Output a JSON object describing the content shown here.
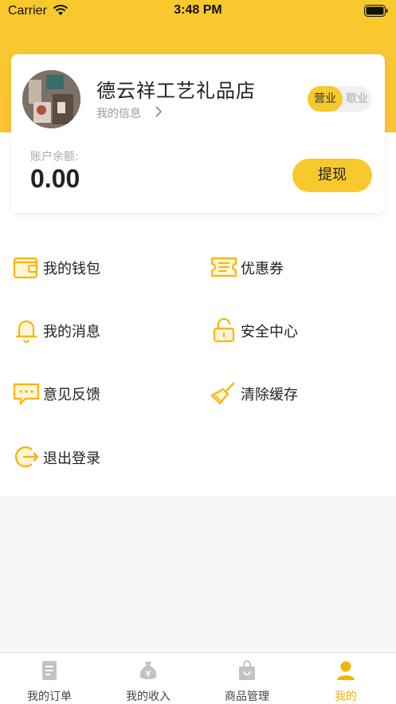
{
  "status_bar": {
    "carrier": "Carrier",
    "time": "3:48 PM"
  },
  "colors": {
    "accent": "#f8c92d",
    "active_tab": "#f5b400",
    "icon_stroke": "#fbb40d"
  },
  "profile": {
    "store_name": "德云祥工艺礼品店",
    "my_info": "我的信息",
    "toggle_open": "营业",
    "toggle_closed": "歇业",
    "balance_label": "账户余额:",
    "balance_value": "0.00",
    "withdraw_label": "提现"
  },
  "menu": [
    {
      "label": "我的钱包",
      "icon": "wallet-icon"
    },
    {
      "label": "优惠券",
      "icon": "coupon-icon"
    },
    {
      "label": "我的消息",
      "icon": "bell-icon"
    },
    {
      "label": "安全中心",
      "icon": "lock-icon"
    },
    {
      "label": "意见反馈",
      "icon": "feedback-icon"
    },
    {
      "label": "清除缓存",
      "icon": "broom-icon"
    },
    {
      "label": "退出登录",
      "icon": "logout-icon"
    }
  ],
  "tabs": [
    {
      "label": "我的订单",
      "icon": "order-icon"
    },
    {
      "label": "我的收入",
      "icon": "money-bag-icon"
    },
    {
      "label": "商品管理",
      "icon": "shopping-bag-icon"
    },
    {
      "label": "我的",
      "icon": "user-icon",
      "active": true
    }
  ]
}
